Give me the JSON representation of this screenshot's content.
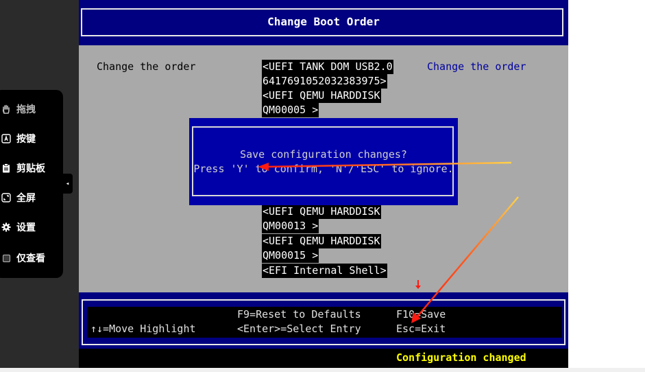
{
  "bios": {
    "title": "Change Boot Order",
    "left_label": "Change the order",
    "help_text": "Change the order",
    "boot_items": [
      "<UEFI TANK DOM USB2.0",
      "6417691052032383975>",
      "<UEFI QEMU HARDDISK",
      "QM00005 >",
      "<UEFI QEMU HARDDISK",
      "QM00013 >",
      "<UEFI QEMU HARDDISK",
      "QM00015 >",
      "<EFI Internal Shell>"
    ],
    "dialog": {
      "line1": "Save configuration changes?",
      "line2": "Press 'Y' to confirm, 'N'/'ESC' to ignore."
    },
    "footer": {
      "move_highlight": "↑↓=Move Highlight",
      "reset_defaults": "F9=Reset to Defaults",
      "select_entry": "<Enter>=Select Entry",
      "save": "F10=Save",
      "exit": "Esc=Exit"
    },
    "status": "Configuration changed"
  },
  "side_panel": {
    "items": [
      {
        "label": "拖拽",
        "icon": "hand-icon"
      },
      {
        "label": "按键",
        "icon": "keyboard-key-icon"
      },
      {
        "label": "剪贴板",
        "icon": "clipboard-icon"
      },
      {
        "label": "全屏",
        "icon": "fullscreen-icon"
      },
      {
        "label": "设置",
        "icon": "gear-icon"
      },
      {
        "label": "仅查看",
        "icon": "checkbox-icon"
      }
    ],
    "collapse_icon": "chevron-left-icon"
  },
  "colors": {
    "bios_blue": "#000080",
    "dialog_blue": "#0000a8",
    "bios_gray": "#a9a9a9",
    "status_yellow": "#ffff00",
    "annotation_red": "#ff2a1a"
  }
}
